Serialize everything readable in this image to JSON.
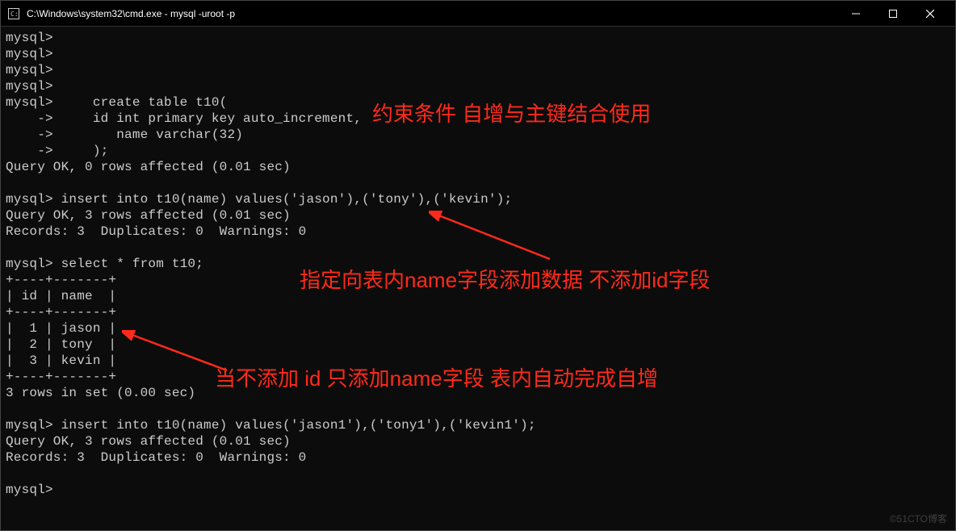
{
  "window": {
    "title": "C:\\Windows\\system32\\cmd.exe - mysql  -uroot -p"
  },
  "terminal": {
    "lines": [
      "mysql>",
      "mysql>",
      "mysql>",
      "mysql>",
      "mysql>     create table t10(",
      "    ->     id int primary key auto_increment,",
      "    ->        name varchar(32)",
      "    ->     );",
      "Query OK, 0 rows affected (0.01 sec)",
      "",
      "mysql> insert into t10(name) values('jason'),('tony'),('kevin');",
      "Query OK, 3 rows affected (0.01 sec)",
      "Records: 3  Duplicates: 0  Warnings: 0",
      "",
      "mysql> select * from t10;",
      "+----+-------+",
      "| id | name  |",
      "+----+-------+",
      "|  1 | jason |",
      "|  2 | tony  |",
      "|  3 | kevin |",
      "+----+-------+",
      "3 rows in set (0.00 sec)",
      "",
      "mysql> insert into t10(name) values('jason1'),('tony1'),('kevin1');",
      "Query OK, 3 rows affected (0.01 sec)",
      "Records: 3  Duplicates: 0  Warnings: 0",
      "",
      "mysql>"
    ]
  },
  "annotations": {
    "a1": "约束条件 自增与主键结合使用",
    "a2": "指定向表内name字段添加数据 不添加id字段",
    "a3": "当不添加 id 只添加name字段 表内自动完成自增"
  },
  "watermark": "©51CTO博客",
  "colors": {
    "annotation": "#ff2a1a",
    "terminal_fg": "#cccccc",
    "terminal_bg": "#0c0c0c"
  }
}
